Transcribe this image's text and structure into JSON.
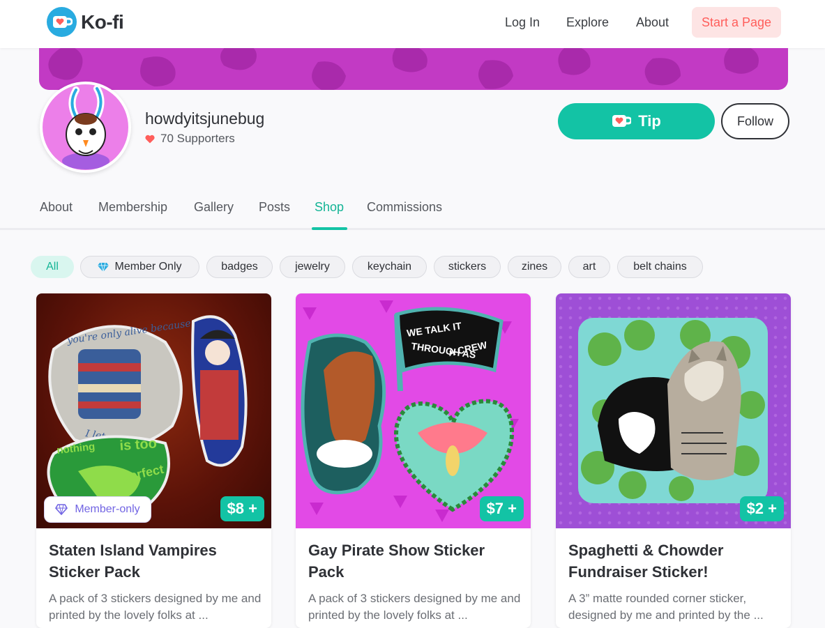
{
  "nav": {
    "logo_text": "Ko-fi",
    "links": [
      "Log In",
      "Explore",
      "About"
    ],
    "cta": "Start a Page"
  },
  "profile": {
    "username": "howdyitsjunebug",
    "supporters": "70 Supporters",
    "tip_label": "Tip",
    "follow_label": "Follow"
  },
  "tabs": [
    "About",
    "Membership",
    "Gallery",
    "Posts",
    "Shop",
    "Commissions"
  ],
  "active_tab": "Shop",
  "filters": [
    "All",
    "Member Only",
    "badges",
    "jewelry",
    "keychain",
    "stickers",
    "zines",
    "art",
    "belt chains"
  ],
  "products": [
    {
      "title": "Staten Island Vampires Sticker Pack",
      "price": "$8 +",
      "badge": "Member-only",
      "description": "A pack of 3 stickers designed by me and printed by the lovely folks at ...",
      "sticker_text": [
        "you're only alive because",
        "I let you live",
        "nothing",
        "is too",
        "perfect"
      ]
    },
    {
      "title": "Gay Pirate Show Sticker Pack",
      "price": "$7 +",
      "description": "A pack of 3 stickers designed by me and printed by the lovely folks at ...",
      "sticker_text": [
        "WE TALK IT",
        "THROUGH AS",
        "A CREW"
      ]
    },
    {
      "title": "Spaghetti & Chowder Fundraiser Sticker!",
      "price": "$2 +",
      "description": "A 3” matte rounded corner sticker, designed by me and printed by the ..."
    }
  ],
  "colors": {
    "accent": "#13c3a5",
    "banner": "#c23ac4",
    "brand_red": "#ff5e5b",
    "member": "#7265e3"
  }
}
